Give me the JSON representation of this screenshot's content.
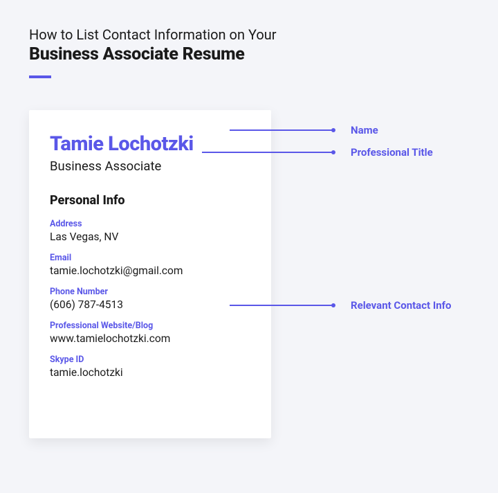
{
  "header": {
    "subtitle": "How to List Contact Information on Your",
    "title": "Business Associate Resume"
  },
  "card": {
    "name": "Tamie Lochotzki",
    "title": "Business Associate",
    "section_title": "Personal Info",
    "fields": {
      "address": {
        "label": "Address",
        "value": "Las Vegas, NV"
      },
      "email": {
        "label": "Email",
        "value": "tamie.lochotzki@gmail.com"
      },
      "phone": {
        "label": "Phone Number",
        "value": "(606) 787-4513"
      },
      "website": {
        "label": "Professional Website/Blog",
        "value": "www.tamielochotzki.com"
      },
      "skype": {
        "label": "Skype ID",
        "value": "tamie.lochotzki"
      }
    }
  },
  "annotations": {
    "name": "Name",
    "professional_title": "Professional Title",
    "contact_info": "Relevant Contact Info"
  }
}
